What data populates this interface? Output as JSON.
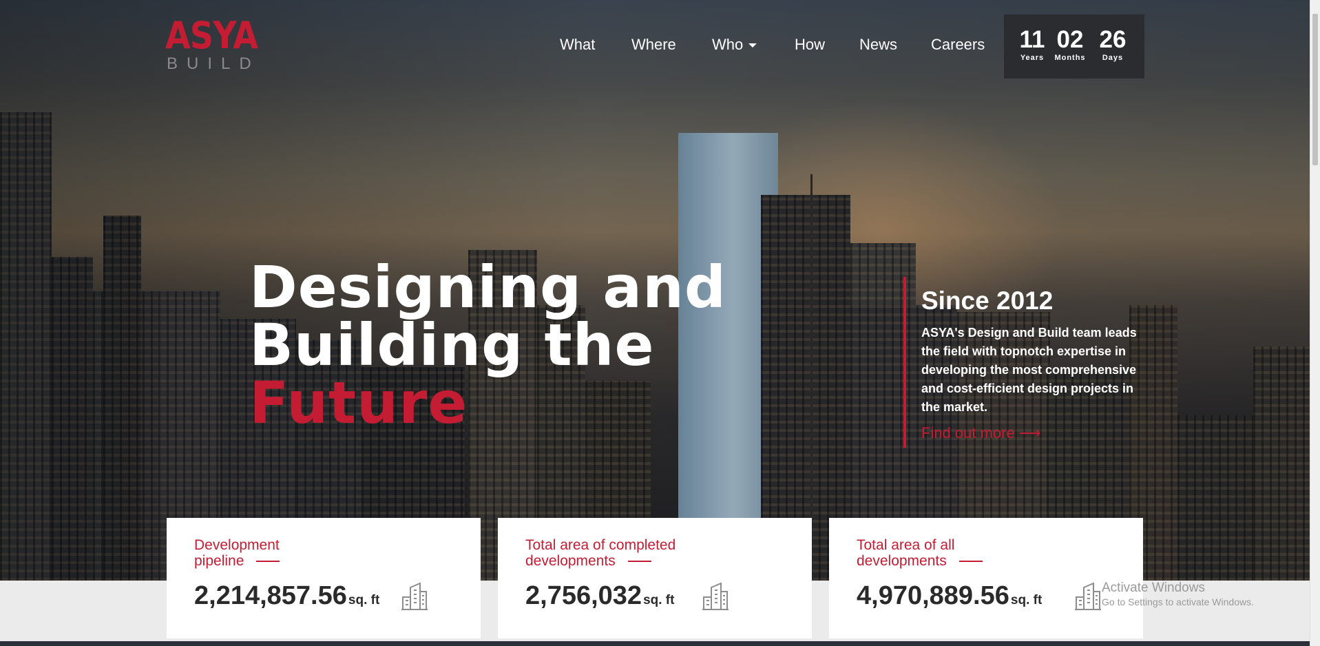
{
  "brand": {
    "name_top": "ASYA",
    "name_bottom": "BUILD",
    "accent": "#c41d33"
  },
  "nav": {
    "items": [
      {
        "label": "What"
      },
      {
        "label": "Where"
      },
      {
        "label": "Who",
        "has_dropdown": true
      },
      {
        "label": "How"
      },
      {
        "label": "News"
      },
      {
        "label": "Careers"
      }
    ]
  },
  "counter": {
    "years": "11",
    "years_label": "Years",
    "months": "02",
    "months_label": "Months",
    "days": "26",
    "days_label": "Days"
  },
  "hero": {
    "line1": "Designing and",
    "line2": "Building the",
    "line3": "Future"
  },
  "since": {
    "title": "Since 2012",
    "text": "ASYA's Design and Build team leads the field with topnotch expertise in developing the most comprehensive and cost-efficient design projects in the market.",
    "link_label": "Find out more ⟶"
  },
  "stats": [
    {
      "label_line1": "Development",
      "label_line2": "pipeline",
      "value": "2,214,857.56",
      "unit": "sq. ft",
      "icon": "building-icon"
    },
    {
      "label_line1": "Total area of completed",
      "label_line2": "developments",
      "value": "2,756,032",
      "unit": "sq. ft",
      "icon": "building-icon"
    },
    {
      "label_line1": "Total area of all",
      "label_line2": "developments",
      "value": "4,970,889.56",
      "unit": "sq. ft",
      "icon": "building-icon"
    }
  ],
  "watermark": {
    "title": "Activate Windows",
    "subtitle": "Go to Settings to activate Windows."
  }
}
